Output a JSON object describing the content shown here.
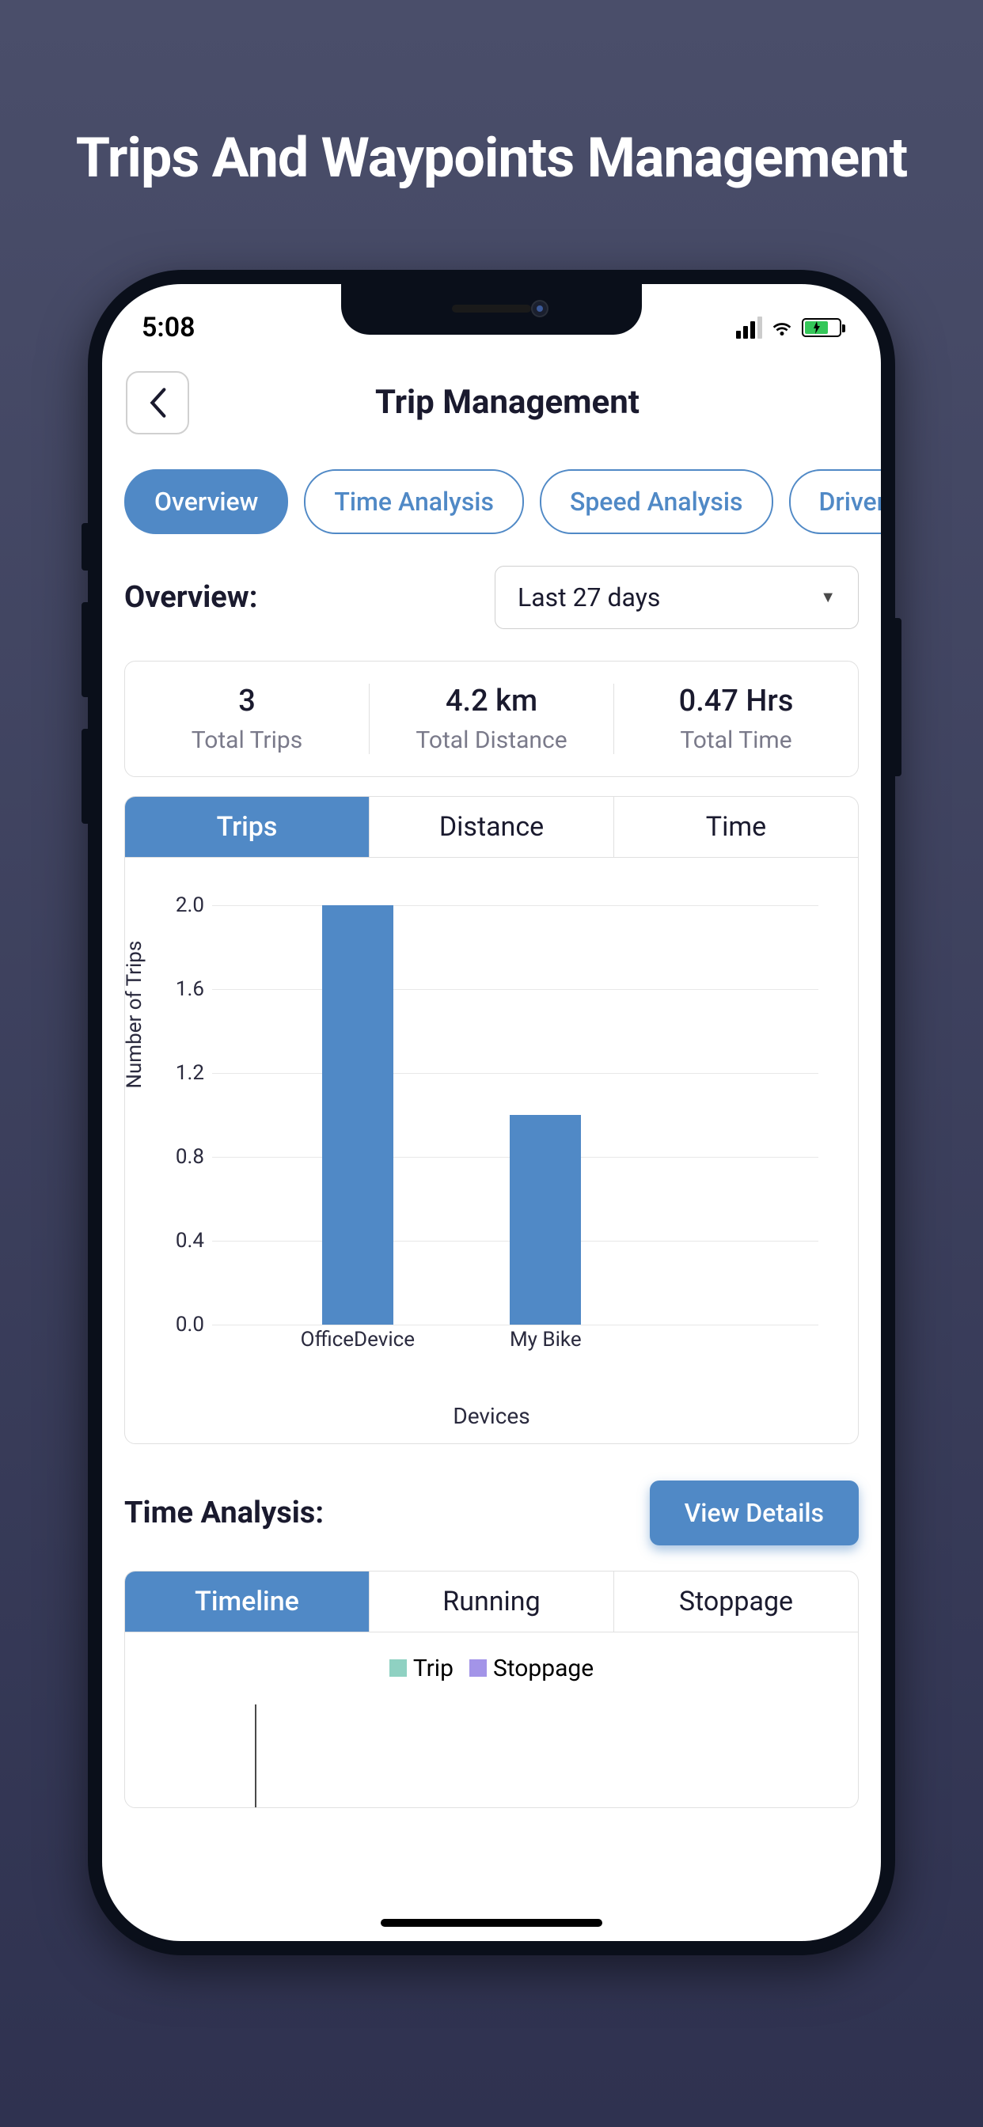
{
  "promo": {
    "title": "Trips And Waypoints Management"
  },
  "status": {
    "time": "5:08"
  },
  "header": {
    "title": "Trip Management"
  },
  "nav_tabs": [
    {
      "label": "Overview",
      "active": true
    },
    {
      "label": "Time Analysis",
      "active": false
    },
    {
      "label": "Speed Analysis",
      "active": false
    },
    {
      "label": "Driver A",
      "active": false
    }
  ],
  "overview": {
    "title": "Overview:",
    "period": "Last 27 days",
    "stats": [
      {
        "value": "3",
        "label": "Total Trips"
      },
      {
        "value": "4.2 km",
        "label": "Total Distance"
      },
      {
        "value": "0.47 Hrs",
        "label": "Total Time"
      }
    ],
    "chart_tabs": [
      {
        "label": "Trips",
        "active": true
      },
      {
        "label": "Distance",
        "active": false
      },
      {
        "label": "Time",
        "active": false
      }
    ]
  },
  "time_analysis": {
    "title": "Time Analysis:",
    "button": "View Details",
    "tabs": [
      {
        "label": "Timeline",
        "active": true
      },
      {
        "label": "Running",
        "active": false
      },
      {
        "label": "Stoppage",
        "active": false
      }
    ],
    "legend": [
      {
        "label": "Trip",
        "color": "#8fd1c2"
      },
      {
        "label": "Stoppage",
        "color": "#a394e8"
      }
    ]
  },
  "chart_data": {
    "type": "bar",
    "title": "",
    "xlabel": "Devices",
    "ylabel": "Number of Trips",
    "ylim": [
      0,
      2.0
    ],
    "y_ticks": [
      0.0,
      0.4,
      0.8,
      1.2,
      1.6,
      2.0
    ],
    "categories": [
      "OfficeDevice",
      "My Bike"
    ],
    "values": [
      2.0,
      1.0
    ]
  }
}
